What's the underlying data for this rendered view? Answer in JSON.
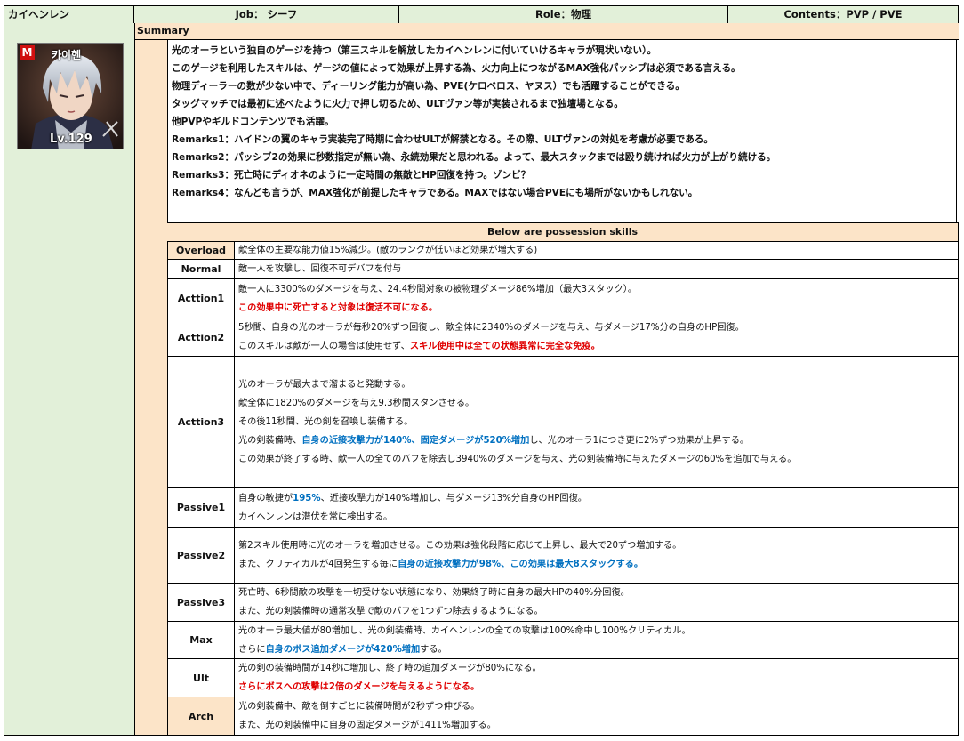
{
  "header": {
    "name": "カイヘンレン",
    "job": "Job： シーフ",
    "role": "Role：物理",
    "contents": "Contents：PVP / PVE"
  },
  "portrait": {
    "badge": "M",
    "name_text": "카이헨",
    "level_text": "Lv.129"
  },
  "summary": {
    "title": "Summary",
    "lines": [
      "光のオーラという独自のゲージを持つ（第三スキルを解放したカイヘンレンに付いていけるキャラが現状いない）。",
      "このゲージを利用したスキルは、ゲージの値によって効果が上昇する為、火力向上につながるMAX強化パッシブは必須である言える。",
      "物理ディーラーの数が少ない中で、ディーリング能力が高い為、PVE(ケロベロス、ヤヌス）でも活躍することができる。",
      "タッグマッチでは最初に述べたように火力で押し切るため、ULTヴァン等が実装されるまで独壇場となる。",
      "他PVPやギルドコンテンツでも活躍。",
      "Remarks1：ハイドンの翼のキャラ実装完了時期に合わせULTが解禁となる。その際、ULTヴァンの対処を考慮が必要である。",
      "Remarks2：パッシブ2の効果に秒数指定が無い為、永続効果だと思われる。よって、最大スタックまでは殴り続ければ火力が上がり続ける。",
      "Remarks3：死亡時にディオネのように一定時間の無敵とHP回復を持つ。ゾンビ？",
      "Remarks4：なんども言うが、MAX強化が前提したキャラである。MAXではない場合PVEにも場所がないかもしれない。"
    ]
  },
  "skills_title": "Below are possession skills",
  "skills": [
    {
      "label": "Overload",
      "lines": [
        [
          "歒全体の主要な能力値15%減少。(敵のランクが低いほど効果が増大する)"
        ]
      ]
    },
    {
      "label": "Normal",
      "lines": [
        [
          "敵一人を攻撃し、回復不可デバフを付与"
        ]
      ]
    },
    {
      "label": "Acttion1",
      "lines": [
        [
          "敵一人に3300%のダメージを与え、24.4秒間対象の被物理ダメージ86%増加（最大3スタック）。"
        ],
        [
          "",
          "この効果中に死亡すると対象は復活不可になる。"
        ]
      ]
    },
    {
      "label": "Acttion2",
      "lines": [
        [
          "5秒間、自身の光のオーラが毎秒20%ずつ回復し、歒全体に2340%のダメージを与え、与ダメージ17%分の自身のHP回復。"
        ],
        [
          "このスキルは歒が一人の場合は使用せず、",
          "スキル使用中は全ての状態異常に完全な免疫。"
        ]
      ]
    },
    {
      "label": "Acttion3",
      "lines": [
        [
          "光のオーラが最大まで溜まると発動する。"
        ],
        [
          "歒全体に1820%のダメージを与え9.3秒間スタンさせる。"
        ],
        [
          "その後11秒間、光の剣を召喚し装備する。"
        ],
        [
          "光の剣装備時、",
          "自身の近接攻撃力が140%、固定ダメージが520%増加",
          "し、光のオーラ1につき更に2%ずつ効果が上昇する。"
        ],
        [
          "この効果が終了する時、歒一人の全てのバフを除去し3940%のダメージを与え、光の剣装備時に与えたダメージの60%を追加で与える。"
        ]
      ]
    },
    {
      "label": "Passive1",
      "lines": [
        [
          "自身の敏捷が",
          "195%",
          "、近接攻撃力が140%増加し、与ダメージ13%分自身のHP回復。"
        ],
        [
          "カイヘンレンは潜伏を常に検出する。"
        ]
      ]
    },
    {
      "label": "Passive2",
      "lines": [
        [
          "第2スキル使用時に光のオーラを増加させる。この効果は強化段階に応じて上昇し、最大で20ずつ増加する。"
        ],
        [
          "また、クリティカルが4回発生する毎に",
          "自身の近接攻撃力が98%、この効果は最大8スタックする。"
        ]
      ]
    },
    {
      "label": "Passive3",
      "lines": [
        [
          "死亡時、6秒間歒の攻撃を一切受けない状態になり、効果終了時に自身の最大HPの40%分回復。"
        ],
        [
          "また、光の剣装備時の通常攻撃で歒のバフを1つずつ除去するようになる。"
        ]
      ]
    },
    {
      "label": "Max",
      "lines": [
        [
          "光のオーラ最大値が80増加し、光の剣装備時、カイヘンレンの全ての攻撃は100%命中し100%クリティカル。"
        ],
        [
          "さらに",
          "自身のボス追加ダメージが420%増加",
          "する。"
        ]
      ]
    },
    {
      "label": "Ult",
      "lines": [
        [
          "光の剣の装備時間が14秒に増加し、終了時の追加ダメージが80%になる。"
        ],
        [
          "",
          "さらにボスへの攻撃は2倍のダメージを与えるようになる。"
        ]
      ]
    },
    {
      "label": "Arch",
      "lines": [
        [
          "光の剣装備中、歒を倒すごとに装備時間が2秒ずつ伸びる。"
        ],
        [
          "また、光の剣装備中に自身の固定ダメージが1411%増加する。"
        ]
      ]
    }
  ],
  "colors": {
    "header_bg": "#e2f0d9",
    "left_col_bg": "#e2f0d9",
    "accent_bg": "#fce4c8",
    "highlight_red": "#e00000",
    "highlight_blue": "#0070c0"
  }
}
